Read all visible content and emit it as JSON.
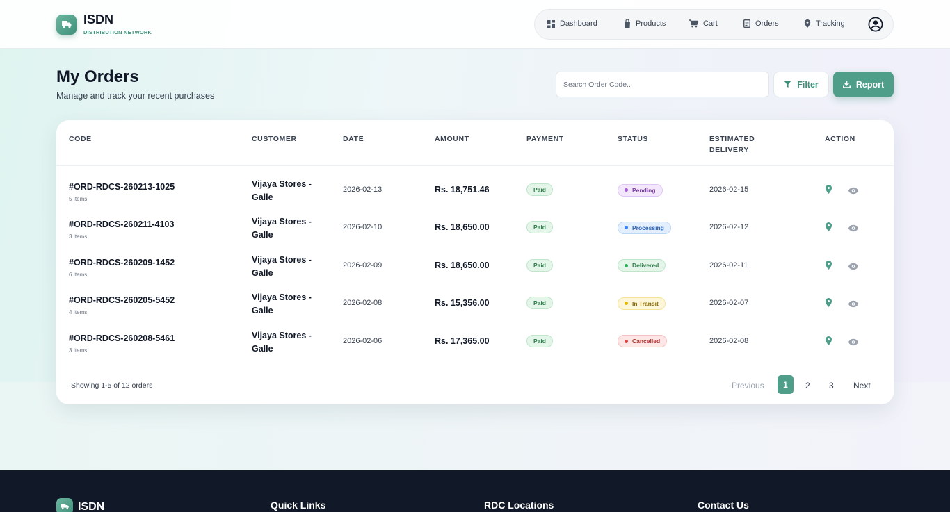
{
  "brand": {
    "name": "ISDN",
    "subtitle": "DISTRIBUTION NETWORK"
  },
  "nav": {
    "items": [
      {
        "label": "Dashboard",
        "icon": "grid-icon"
      },
      {
        "label": "Products",
        "icon": "bag-icon"
      },
      {
        "label": "Cart",
        "icon": "cart-icon"
      },
      {
        "label": "Orders",
        "icon": "receipt-icon"
      },
      {
        "label": "Tracking",
        "icon": "map-pin-icon"
      }
    ]
  },
  "page": {
    "title": "My Orders",
    "subtitle": "Manage and track your recent purchases",
    "search_placeholder": "Search Order Code..",
    "filter_label": "Filter",
    "report_label": "Report"
  },
  "table": {
    "headers": [
      "CODE",
      "CUSTOMER",
      "DATE",
      "AMOUNT",
      "PAYMENT",
      "STATUS",
      "ESTIMATED DELIVERY",
      "ACTION"
    ],
    "rows": [
      {
        "code": "#ORD-RDCS-260213-1025",
        "items": "5 Items",
        "customer": "Vijaya Stores - Galle",
        "date": "2026-02-13",
        "amount": "Rs. 18,751.46",
        "payment": "Paid",
        "status": "Pending",
        "delivery": "2026-02-15"
      },
      {
        "code": "#ORD-RDCS-260211-4103",
        "items": "3 Items",
        "customer": "Vijaya Stores - Galle",
        "date": "2026-02-10",
        "amount": "Rs. 18,650.00",
        "payment": "Paid",
        "status": "Processing",
        "delivery": "2026-02-12"
      },
      {
        "code": "#ORD-RDCS-260209-1452",
        "items": "6 Items",
        "customer": "Vijaya Stores - Galle",
        "date": "2026-02-09",
        "amount": "Rs. 18,650.00",
        "payment": "Paid",
        "status": "Delivered",
        "delivery": "2026-02-11"
      },
      {
        "code": "#ORD-RDCS-260205-5452",
        "items": "4 Items",
        "customer": "Vijaya Stores - Galle",
        "date": "2026-02-08",
        "amount": "Rs. 15,356.00",
        "payment": "Paid",
        "status": "In Transit",
        "delivery": "2026-02-07"
      },
      {
        "code": "#ORD-RDCS-260208-5461",
        "items": "3 Items",
        "customer": "Vijaya Stores - Galle",
        "date": "2026-02-06",
        "amount": "Rs. 17,365.00",
        "payment": "Paid",
        "status": "Cancelled",
        "delivery": "2026-02-08"
      }
    ]
  },
  "status_colors": {
    "Pending": {
      "bg": "#f3e8fb",
      "border": "#dfc4f2",
      "text": "#7e3fae",
      "dot": "#a45bd6"
    },
    "Processing": {
      "bg": "#e3effd",
      "border": "#bcd7f6",
      "text": "#2d62b5",
      "dot": "#3b82f6"
    },
    "Delivered": {
      "bg": "#e3f6e9",
      "border": "#bfe6cb",
      "text": "#2f7d4a",
      "dot": "#2fb25c"
    },
    "In Transit": {
      "bg": "#fdf6d8",
      "border": "#f3e39a",
      "text": "#8a6a0c",
      "dot": "#e6b800"
    },
    "Cancelled": {
      "bg": "#fde6e6",
      "border": "#f4c2c2",
      "text": "#b0322f",
      "dot": "#e04545"
    }
  },
  "pagination": {
    "showing": "Showing 1-5 of 12 orders",
    "previous": "Previous",
    "pages": [
      "1",
      "2",
      "3"
    ],
    "active": "1",
    "next": "Next"
  },
  "footer": {
    "brand": "ISDN",
    "headings": [
      "Quick Links",
      "RDC Locations",
      "Contact Us"
    ]
  },
  "colors": {
    "accent": "#4f9e89",
    "dark": "#111827"
  }
}
